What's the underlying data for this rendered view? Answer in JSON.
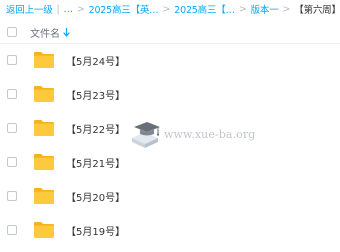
{
  "breadcrumb": {
    "back": "返回上一级",
    "items": [
      "2025高三【英…",
      "2025高三【…",
      "版本一"
    ],
    "current": "【第六周】"
  },
  "list_header": {
    "name_label": "文件名"
  },
  "folders": [
    {
      "name": "【5月24号】"
    },
    {
      "name": "【5月23号】"
    },
    {
      "name": "【5月22号】"
    },
    {
      "name": "【5月21号】"
    },
    {
      "name": "【5月20号】"
    },
    {
      "name": "【5月19号】"
    }
  ],
  "watermark": {
    "text": "www.xue-ba.org"
  },
  "colors": {
    "link": "#06a7ff",
    "folder": "#ffc93d",
    "folder_back": "#f5b21f"
  }
}
